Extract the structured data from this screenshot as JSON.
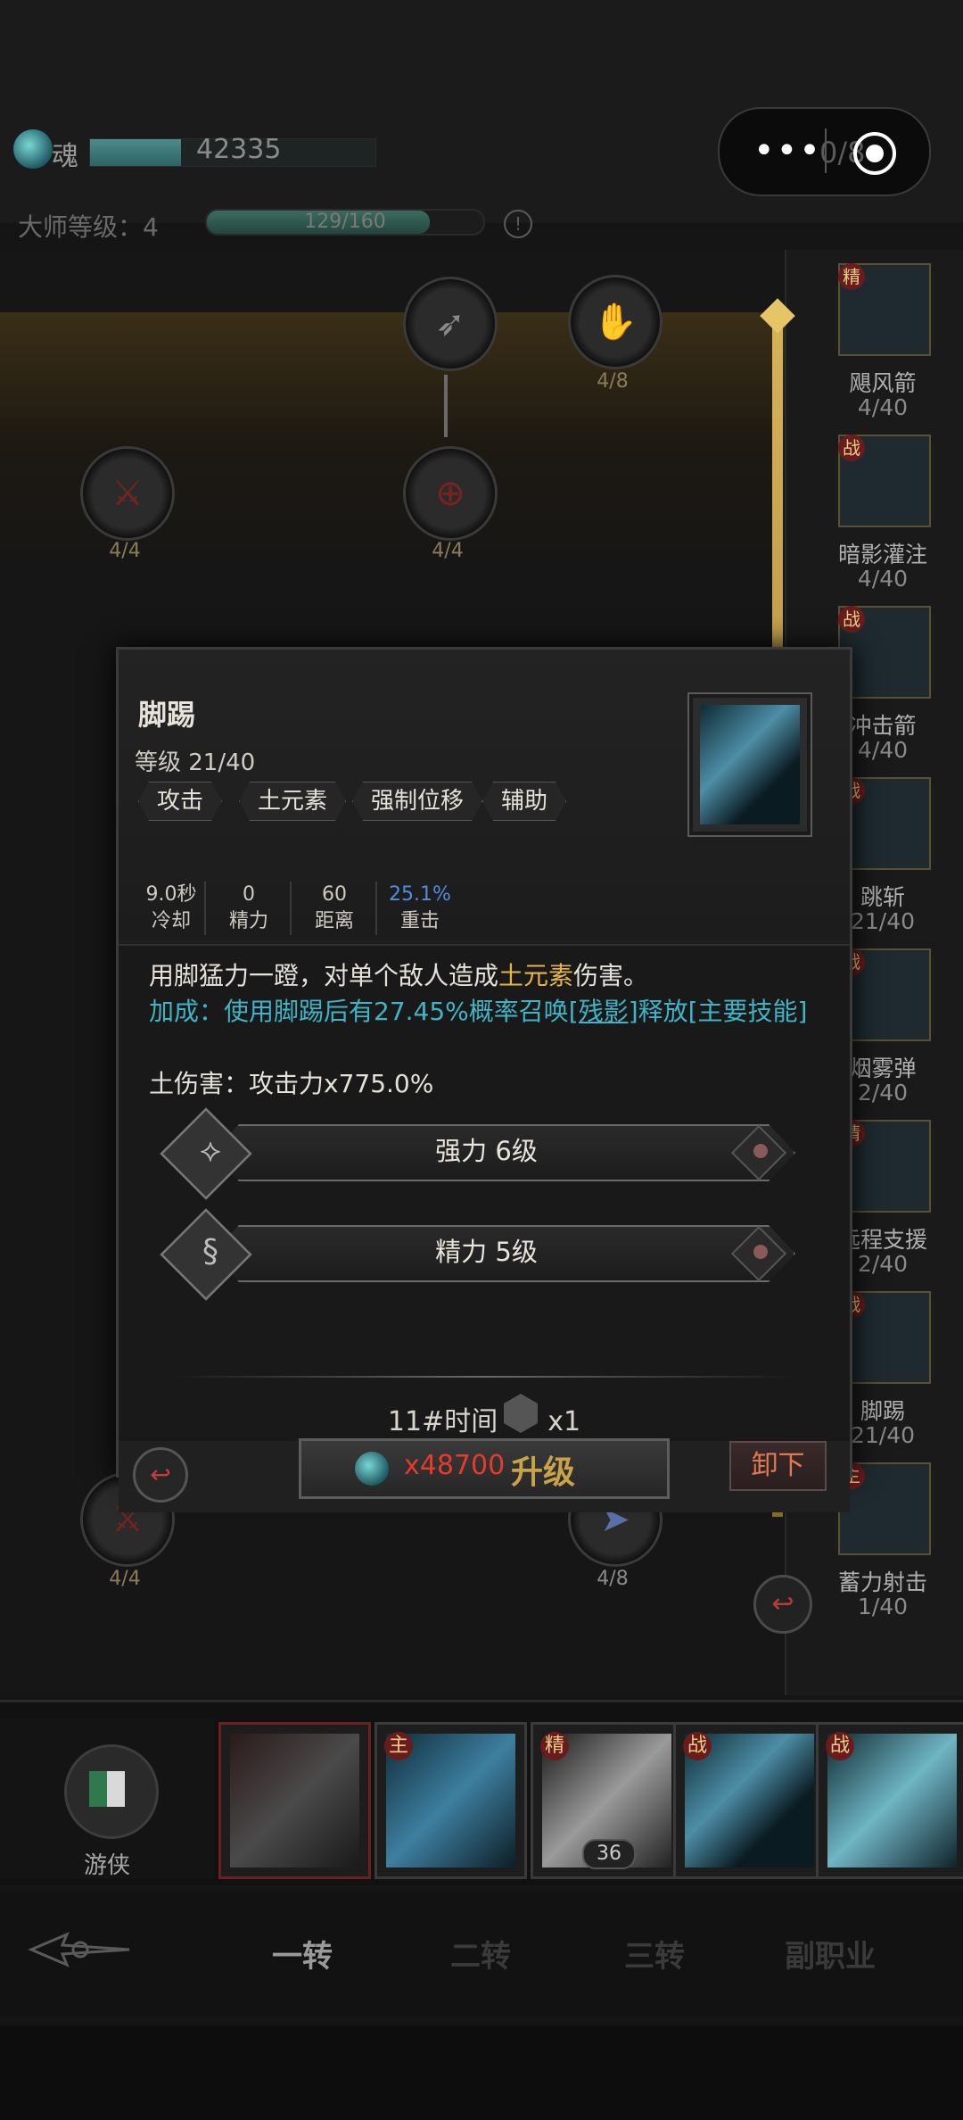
{
  "top": {
    "soul_label": "魂",
    "soul_value": "42335",
    "master_label": "大师等级：4",
    "master_progress": "129/160",
    "master_progress_fraction": 0.806,
    "capsule_partial_text": "0/8"
  },
  "tree_nodes": [
    {
      "count": "4/4"
    },
    {
      "count": "4/4"
    },
    {
      "count": "4/4"
    },
    {
      "count": "4/4"
    },
    {
      "count": "4/8"
    }
  ],
  "side_skills": [
    {
      "badge": "精",
      "name": "飓风箭",
      "level": "4/40"
    },
    {
      "badge": "战",
      "name": "暗影灌注",
      "level": "4/40"
    },
    {
      "badge": "战",
      "name": "冲击箭",
      "level": "4/40"
    },
    {
      "badge": "战",
      "name": "跳斩",
      "level": "21/40"
    },
    {
      "badge": "战",
      "name": "烟雾弹",
      "level": "2/40"
    },
    {
      "badge": "精",
      "name": "远程支援",
      "level": "2/40"
    },
    {
      "badge": "战",
      "name": "脚踢",
      "level": "21/40"
    },
    {
      "badge": "主",
      "name": "蓄力射击",
      "level": "1/40"
    }
  ],
  "popup": {
    "title": "脚踢",
    "level": "等级 21/40",
    "tags": [
      "攻击",
      "土元素",
      "强制位移",
      "辅助"
    ],
    "stats": [
      {
        "value": "9.0秒",
        "label": "冷却"
      },
      {
        "value": "0",
        "label": "精力"
      },
      {
        "value": "60",
        "label": "距离"
      },
      {
        "value": "25.1%",
        "label": "重击"
      }
    ],
    "desc_prefix": "用脚猛力一蹬，对单个敌人造成",
    "desc_highlight": "土元素",
    "desc_suffix": "伤害。",
    "bonus_prefix": "加成：使用脚踢后有27.45%概率召唤",
    "bonus_link": "[残影]",
    "bonus_suffix": "释放[主要技能]",
    "damage_line": "土伤害：攻击力x775.0%",
    "runes": [
      {
        "label": "强力 6级",
        "glyph": "⟡"
      },
      {
        "label": "精力 5级",
        "glyph": "§"
      }
    ],
    "time_label": "11#时间",
    "time_count": "x1",
    "upgrade_cost": "x48700",
    "upgrade_label": "升级",
    "unequip_label": "卸下"
  },
  "skill_bar": {
    "class_name": "游侠",
    "slots": [
      {
        "badge": ""
      },
      {
        "badge": "主"
      },
      {
        "badge": "精",
        "count": "36"
      },
      {
        "badge": "战"
      },
      {
        "badge": "战"
      }
    ]
  },
  "tabs": [
    {
      "label": "一转",
      "active": true
    },
    {
      "label": "二转",
      "active": false
    },
    {
      "label": "三转",
      "active": false
    },
    {
      "label": "副职业",
      "active": false
    }
  ],
  "colors": {
    "accent_gold": "#c9a347",
    "cost_red": "#e53b2d",
    "bonus_cyan": "#3fb4c6"
  }
}
